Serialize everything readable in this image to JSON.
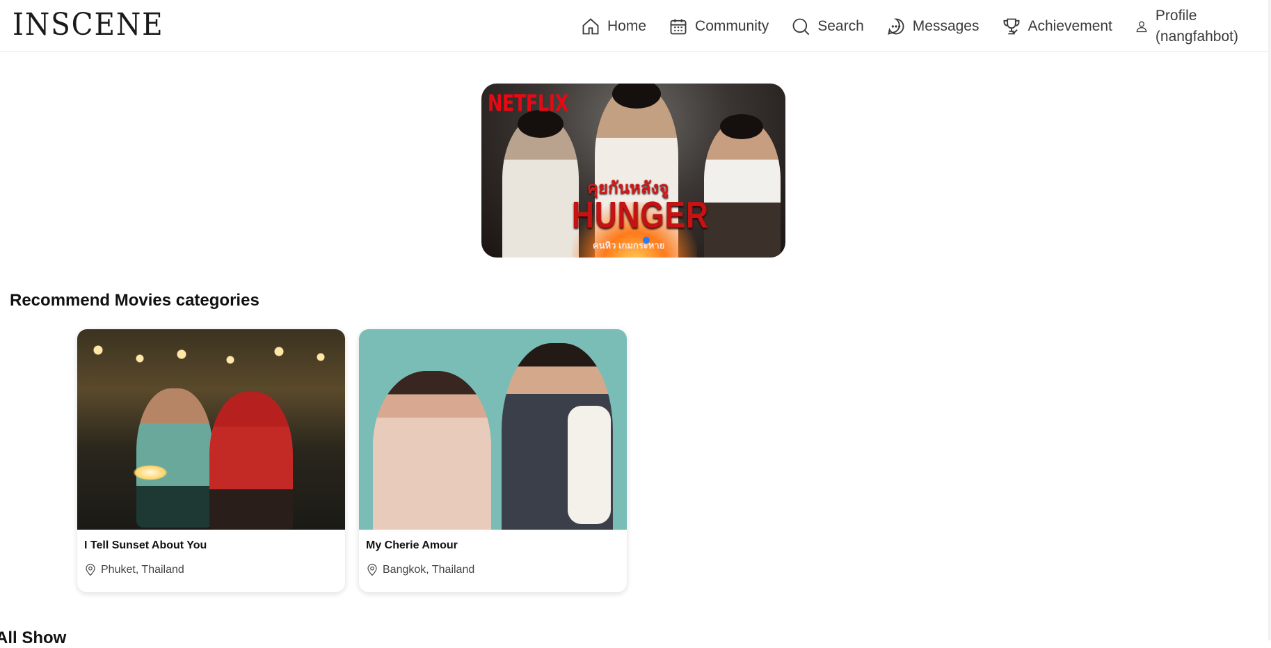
{
  "app": {
    "logo": "INSCENE"
  },
  "nav": {
    "items": [
      {
        "label": "Home",
        "icon": "home-icon"
      },
      {
        "label": "Community",
        "icon": "calendar-icon"
      },
      {
        "label": "Search",
        "icon": "search-icon"
      },
      {
        "label": "Messages",
        "icon": "chat-bubble-icon"
      },
      {
        "label": "Achievement",
        "icon": "trophy-icon"
      }
    ],
    "profile": {
      "label": "Profile",
      "username": "(nangfahbot)",
      "icon": "user-icon"
    }
  },
  "banner": {
    "brand": "NETFLIX",
    "thai_title": "คุยกันหลังจู",
    "title": "HUNGER",
    "tagline": "คนหิว เกมกระหาย",
    "brand_color": "#e50914"
  },
  "recommend": {
    "title": "Recommend Movies categories",
    "cards": [
      {
        "title": "I Tell Sunset About You",
        "location": "Phuket, Thailand",
        "location_icon": "map-pin-icon"
      },
      {
        "title": "My Cherie Amour",
        "location": "Bangkok, Thailand",
        "location_icon": "map-pin-icon"
      }
    ]
  },
  "all_show": {
    "title": "All Show"
  }
}
